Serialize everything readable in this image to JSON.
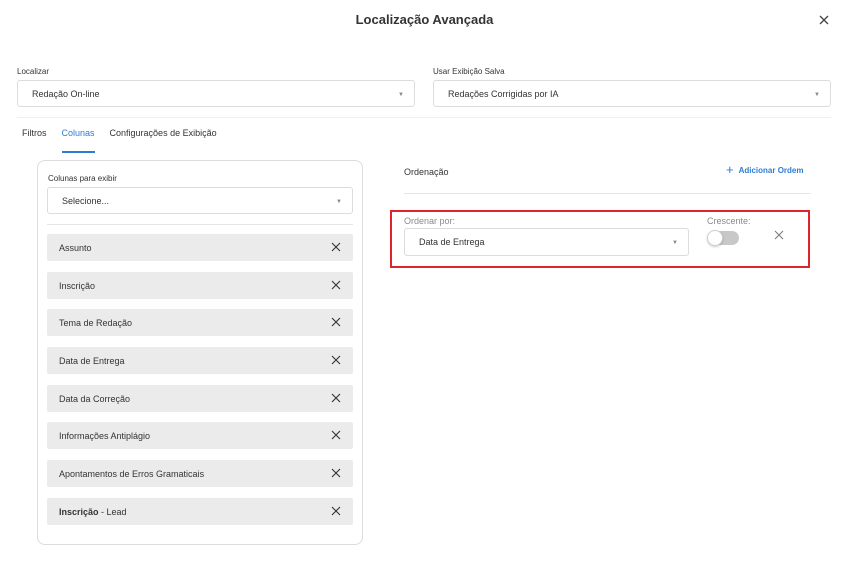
{
  "dialog": {
    "title": "Localização Avançada"
  },
  "localizar": {
    "label": "Localizar",
    "value": "Redação On-line"
  },
  "exibicao_salva": {
    "label": "Usar Exibição Salva",
    "value": "Redações Corrigidas por IA"
  },
  "tabs": [
    {
      "label": "Filtros",
      "active": false
    },
    {
      "label": "Colunas",
      "active": true
    },
    {
      "label": "Configurações de Exibição",
      "active": false
    }
  ],
  "colunas": {
    "label": "Colunas para exibir",
    "placeholder": "Selecione...",
    "items": [
      {
        "label": "Assunto"
      },
      {
        "label": "Inscrição"
      },
      {
        "label": "Tema de Redação"
      },
      {
        "label": "Data de Entrega"
      },
      {
        "label": "Data da Correção"
      },
      {
        "label": "Informações Antiplágio"
      },
      {
        "label": "Apontamentos de Erros Gramaticais"
      },
      {
        "label_bold": "Inscrição",
        "label_rest": " - Lead"
      }
    ]
  },
  "ordenacao": {
    "title": "Ordenação",
    "add_label": "Adicionar Ordem",
    "ordenar_por_label": "Ordenar por:",
    "ordenar_por_value": "Data de Entrega",
    "crescente_label": "Crescente:",
    "crescente_on": false
  },
  "colors": {
    "accent": "#2e7cd6",
    "highlight": "#e0242d"
  }
}
